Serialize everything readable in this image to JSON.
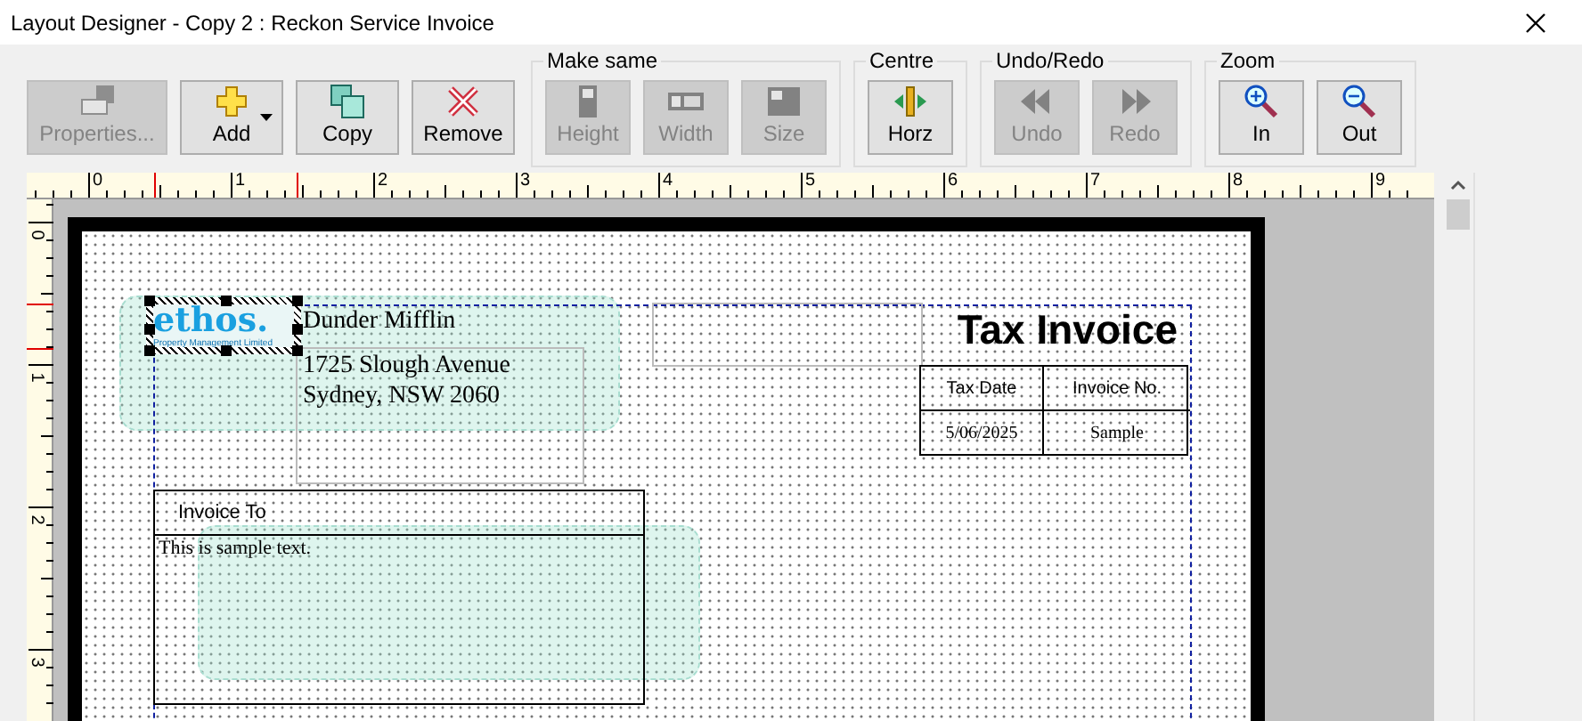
{
  "window": {
    "title": "Layout Designer - Copy 2 : Reckon Service Invoice"
  },
  "toolbar": {
    "buttons": [
      {
        "label": "Properties...",
        "kind": "properties",
        "disabled": true,
        "dropdown": false
      },
      {
        "label": "Add",
        "kind": "add",
        "disabled": false,
        "dropdown": true
      },
      {
        "label": "Copy",
        "kind": "copy",
        "disabled": false,
        "dropdown": false
      },
      {
        "label": "Remove",
        "kind": "remove",
        "disabled": false,
        "dropdown": false
      }
    ],
    "groups": [
      {
        "title": "Make same",
        "buttons": [
          {
            "label": "Height",
            "kind": "height",
            "disabled": true
          },
          {
            "label": "Width",
            "kind": "width",
            "disabled": true
          },
          {
            "label": "Size",
            "kind": "size",
            "disabled": true
          }
        ]
      },
      {
        "title": "Centre",
        "buttons": [
          {
            "label": "Horz",
            "kind": "horz",
            "disabled": false
          }
        ]
      },
      {
        "title": "Undo/Redo",
        "buttons": [
          {
            "label": "Undo",
            "kind": "undo",
            "disabled": true
          },
          {
            "label": "Redo",
            "kind": "redo",
            "disabled": true
          }
        ]
      },
      {
        "title": "Zoom",
        "buttons": [
          {
            "label": "In",
            "kind": "zoom_in",
            "disabled": false
          },
          {
            "label": "Out",
            "kind": "zoom_out",
            "disabled": false
          }
        ]
      }
    ]
  },
  "rulers": {
    "horizontal": [
      "0",
      "1",
      "2",
      "3",
      "4",
      "5",
      "6",
      "7",
      "8",
      "9"
    ],
    "vertical": [
      "0",
      "1",
      "2",
      "3"
    ]
  },
  "layout": {
    "logo": {
      "text": "ethos.",
      "tagline": "Property Management Limited",
      "selected": true
    },
    "company": {
      "name": "Dunder Mifflin",
      "address": [
        "1725 Slough Avenue",
        "Sydney, NSW 2060"
      ]
    },
    "title": "Tax Invoice",
    "info_table": {
      "columns": [
        "Tax Date",
        "Invoice No."
      ],
      "values": [
        "5/06/2025",
        "Sample"
      ]
    },
    "invoice_to": {
      "heading": "Invoice To",
      "text": "This is sample text."
    }
  }
}
